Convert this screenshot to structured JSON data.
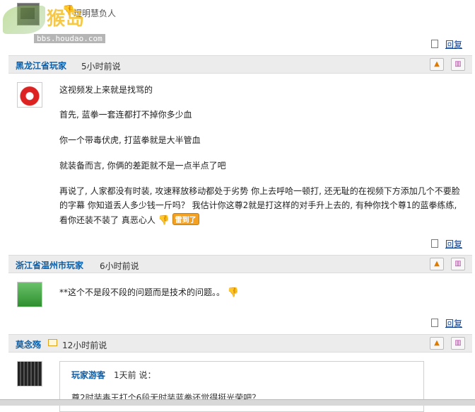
{
  "top": {
    "partial_text": "理明慧负人",
    "watermark_logo": "猴岛",
    "watermark_url": "bbs.houdao.com"
  },
  "reply_label": "回复",
  "comments": [
    {
      "user": "黑龙江省玩家",
      "time": "5小时前说",
      "lines": [
        "这视频发上来就是找骂的",
        "首先, 蓝拳一套连都打不掉你多少血",
        "你一个带毒伏虎, 打蓝拳就是大半管血",
        "就装备而言, 你俩的差距就不是一点半点了吧",
        "再说了, 人家都没有时装, 攻速释放移动都处于劣势  你上去呼哈一顿打, 还无耻的在视频下方添加几个不要脸",
        "的字幕  你知道丢人多少钱一斤吗？ 我估计你这尊2就是打这样的对手升上去的,  有种你找个尊1的蓝拳练练,",
        "看你还装不装了  真恶心人"
      ],
      "badge": "雷到了"
    },
    {
      "user": "浙江省温州市玩家",
      "time": "6小时前说",
      "lines": [
        "**这个不是段不段的问题而是技术的问题。。"
      ]
    },
    {
      "user": "莫念殇",
      "time": "12小时前说",
      "quote": {
        "user": "玩家游客",
        "meta": "1天前 说：",
        "text": "尊2时装毒王打个6段无时装蓝拳还觉得挺光荣吧？"
      }
    }
  ],
  "colors": {
    "header_bg": "#ececec",
    "username": "#0b5ea8",
    "link": "#0b3d91"
  },
  "icons": {
    "reply": "document-icon",
    "up": "thumb-up-icon",
    "trash": "trash-icon",
    "mood": "thumb-down-icon",
    "mail": "mail-icon"
  }
}
